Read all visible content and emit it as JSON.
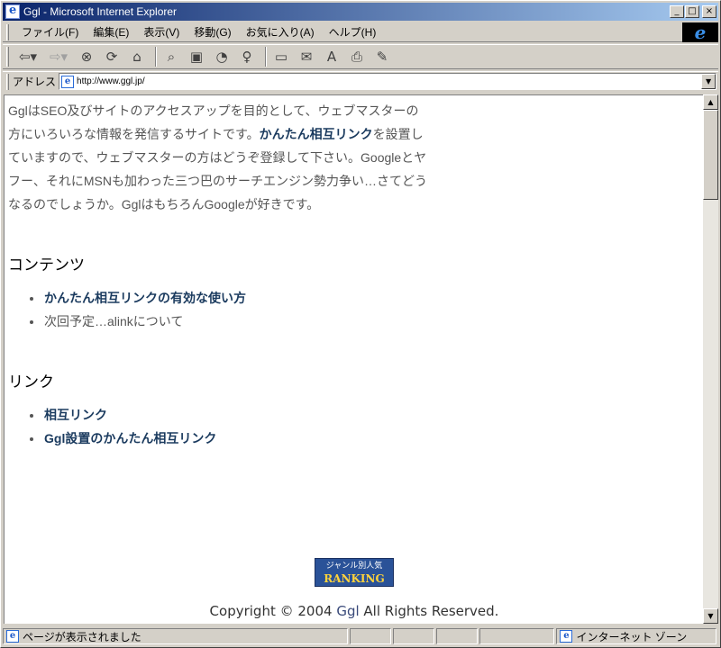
{
  "window": {
    "title": "Ggl - Microsoft Internet Explorer"
  },
  "menu": {
    "items": [
      "ファイル(F)",
      "編集(E)",
      "表示(V)",
      "移動(G)",
      "お気に入り(A)",
      "ヘルプ(H)"
    ]
  },
  "address": {
    "label": "アドレス",
    "url": "http://www.ggl.jp/"
  },
  "page": {
    "intro_part1": "GglはSEO及びサイトのアクセスアップを目的として、ウェブマスターの方にいろいろな情報を発信するサイトです。",
    "intro_link": "かんたん相互リンク",
    "intro_part2": "を設置していますので、ウェブマスターの方はどうぞ登録して下さい。Googleとヤフー、それにMSNも加わった三つ巴のサーチエンジン勢力争い…さてどうなるのでしょうか。GglはもちろんGoogleが好きです。",
    "contents_heading": "コンテンツ",
    "contents_items": [
      {
        "label": "かんたん相互リンクの有効な使い方",
        "link": true
      },
      {
        "label": "次回予定…alinkについて",
        "link": false
      }
    ],
    "links_heading": "リンク",
    "links_items": [
      {
        "label": "相互リンク"
      },
      {
        "label": "Ggl設置のかんたん相互リンク"
      }
    ],
    "ranking_line1": "ジャンル別人気",
    "ranking_line2": "RANKING",
    "footer_pre": "Copyright © 2004 ",
    "footer_brand": "Ggl",
    "footer_post": " All Rights Reserved."
  },
  "status": {
    "text": "ページが表示されました",
    "zone": "インターネット ゾーン"
  }
}
